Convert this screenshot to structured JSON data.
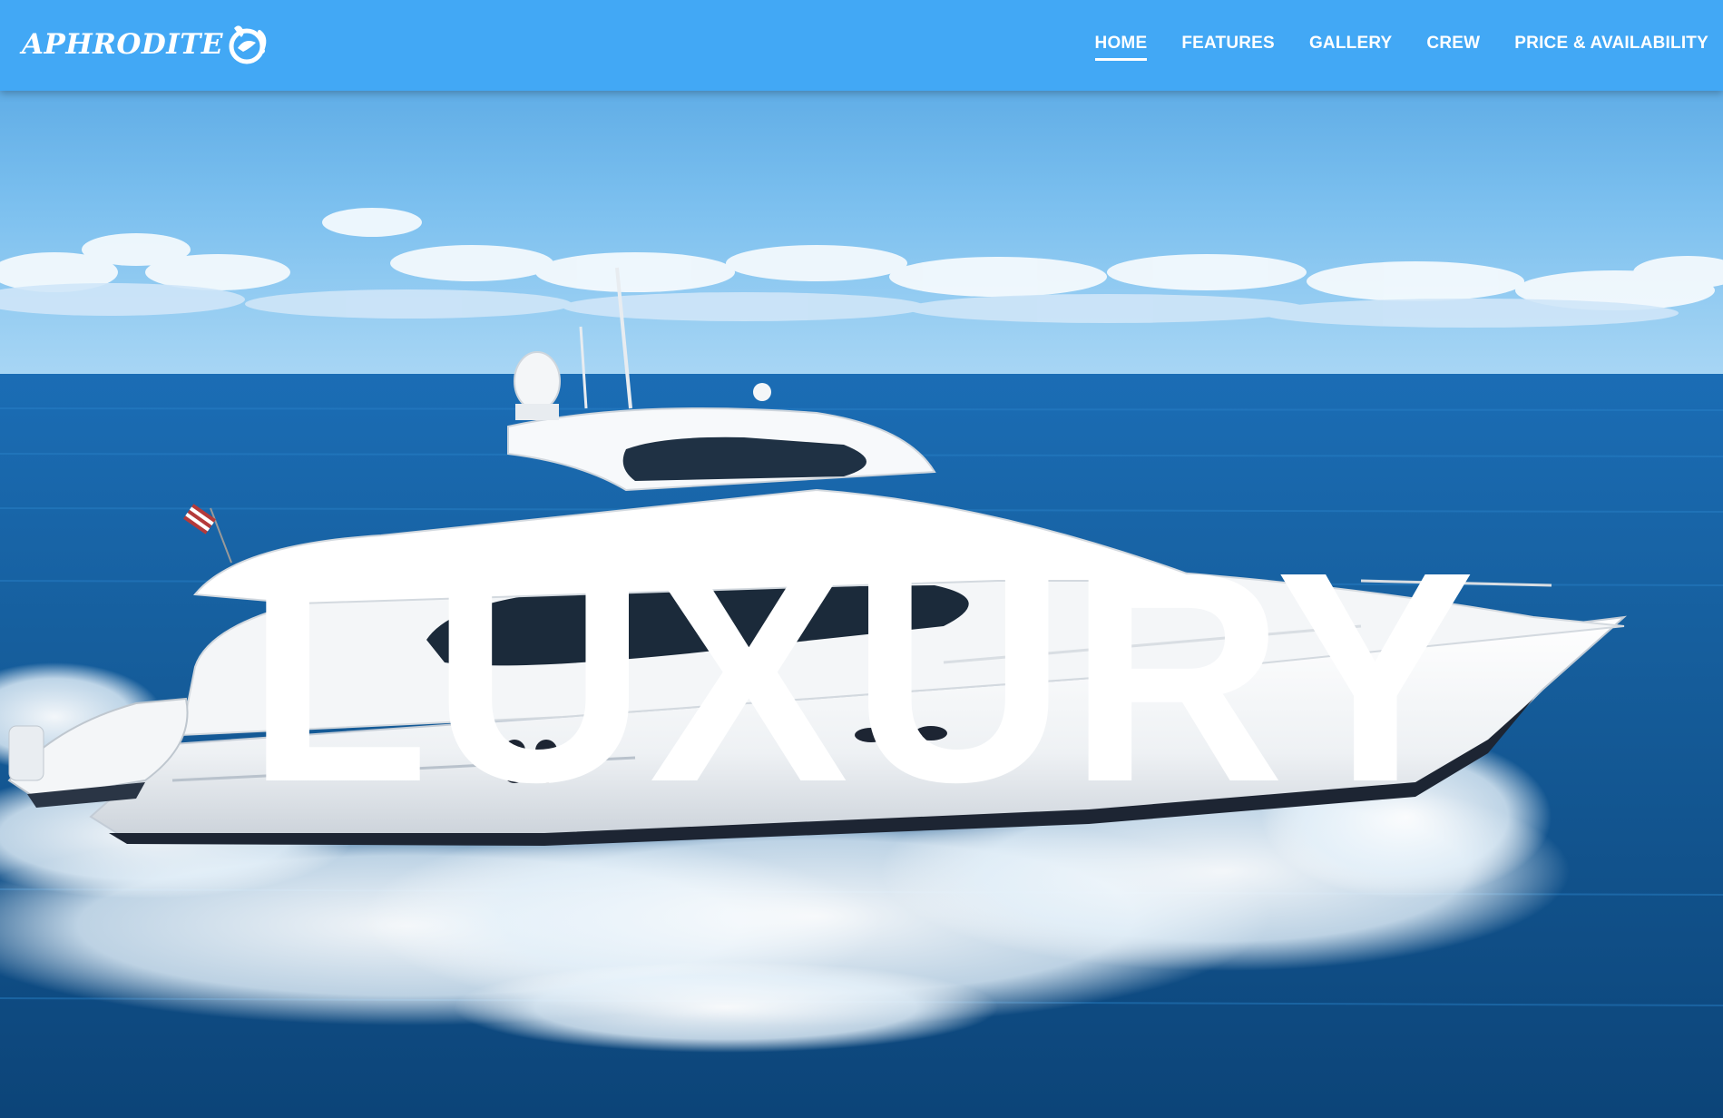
{
  "brand": {
    "name": "APHRODITE",
    "logo_icon": "mermaid-icon"
  },
  "nav": {
    "items": [
      {
        "label": "HOME",
        "active": true
      },
      {
        "label": "FEATURES",
        "active": false
      },
      {
        "label": "GALLERY",
        "active": false
      },
      {
        "label": "CREW",
        "active": false
      },
      {
        "label": "PRICE & AVAILABILITY",
        "active": false
      }
    ]
  },
  "hero": {
    "headline": "LUXURY",
    "image": "white-motor-yacht-on-open-sea"
  },
  "colors": {
    "nav_background": "#42a8f5",
    "text": "#ffffff",
    "sea_deep": "#0f4f8a",
    "sky": "#6fb7ea"
  }
}
